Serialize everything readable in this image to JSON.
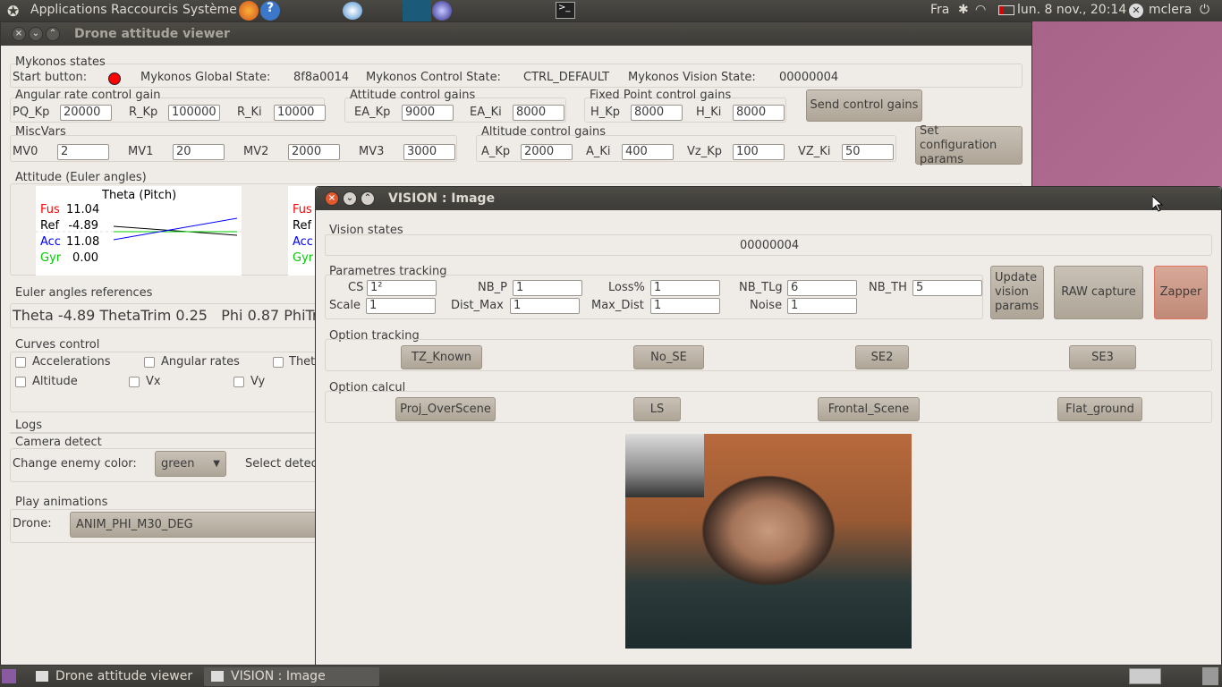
{
  "topbar": {
    "menus": [
      "Applications",
      "Raccourcis",
      "Système"
    ],
    "keyboard": "Fra",
    "datetime": "lun.  8 nov., 20:14",
    "user": "mclera"
  },
  "main_window": {
    "title": "Drone attitude viewer",
    "mykonos": {
      "title": "Mykonos states",
      "start_label": "Start button:",
      "start_color": "#ff0000",
      "global_label": "Mykonos Global State:",
      "global_value": "8f8a0014",
      "control_label": "Mykonos Control State:",
      "control_value": "CTRL_DEFAULT",
      "vision_label": "Mykonos Vision State:",
      "vision_value": "00000004"
    },
    "angular": {
      "title": "Angular rate control gain",
      "fields": [
        {
          "label": "PQ_Kp",
          "value": "20000"
        },
        {
          "label": "R_Kp",
          "value": "100000"
        },
        {
          "label": "R_Ki",
          "value": "10000"
        }
      ]
    },
    "attitude_gains": {
      "title": "Attitude control gains",
      "fields": [
        {
          "label": "EA_Kp",
          "value": "9000"
        },
        {
          "label": "EA_Ki",
          "value": "8000"
        }
      ]
    },
    "fixed_point": {
      "title": "Fixed Point control gains",
      "fields": [
        {
          "label": "H_Kp",
          "value": "8000"
        },
        {
          "label": "H_Ki",
          "value": "8000"
        }
      ]
    },
    "send_gains": "Send control gains",
    "misc": {
      "title": "MiscVars",
      "fields": [
        {
          "label": "MV0",
          "value": "2"
        },
        {
          "label": "MV1",
          "value": "20"
        },
        {
          "label": "MV2",
          "value": "2000"
        },
        {
          "label": "MV3",
          "value": "3000"
        }
      ]
    },
    "altitude": {
      "title": "Altitude control gains",
      "fields": [
        {
          "label": "A_Kp",
          "value": "2000"
        },
        {
          "label": "A_Ki",
          "value": "400"
        },
        {
          "label": "Vz_Kp",
          "value": "100"
        },
        {
          "label": "VZ_Ki",
          "value": "50"
        }
      ]
    },
    "set_config": "Set configuration params",
    "attitude": {
      "title": "Attitude (Euler angles)",
      "plot_title": "Theta (Pitch)",
      "rows": [
        {
          "label": "Fus",
          "value": "11.04",
          "color": "#ff0000"
        },
        {
          "label": "Ref",
          "value": "-4.89",
          "color": "#000000"
        },
        {
          "label": "Acc",
          "value": "11.08",
          "color": "#0000ff"
        },
        {
          "label": "Gyr",
          "value": "0.00",
          "color": "#00cc00"
        }
      ],
      "second_labels": [
        "Fus",
        "Ref",
        "Acc",
        "Gyr"
      ]
    },
    "euler_refs": {
      "title": "Euler angles references",
      "text": "Theta -4.89 ThetaTrim 0.25   Phi 0.87 PhiTr"
    },
    "curves": {
      "title": "Curves control",
      "items": [
        "Accelerations",
        "Angular rates",
        "Thet",
        "Altitude",
        "Vx",
        "Vy"
      ]
    },
    "logs": "Logs",
    "camera": {
      "title": "Camera detect",
      "color_label": "Change enemy color:",
      "color_value": "green",
      "select_label": "Select detec"
    },
    "anim": {
      "title": "Play animations",
      "drone_label": "Drone:",
      "value": "ANIM_PHI_M30_DEG"
    }
  },
  "vision_window": {
    "title": "VISION : Image",
    "states": {
      "title": "Vision states",
      "value": "00000004"
    },
    "tracking": {
      "title": "Parametres tracking",
      "fields": [
        {
          "label": "CS",
          "value": "1²"
        },
        {
          "label": "NB_P",
          "value": "1"
        },
        {
          "label": "Loss%",
          "value": "1"
        },
        {
          "label": "NB_TLg",
          "value": "6"
        },
        {
          "label": "NB_TH",
          "value": "5"
        },
        {
          "label": "Scale",
          "value": "1"
        },
        {
          "label": "Dist_Max",
          "value": "1"
        },
        {
          "label": "Max_Dist",
          "value": "1"
        },
        {
          "label": "Noise",
          "value": "1"
        }
      ]
    },
    "update_btn": "Update vision params",
    "raw_btn": "RAW capture",
    "zapper_btn": "Zapper",
    "option_tracking": {
      "title": "Option tracking",
      "buttons": [
        "TZ_Known",
        "No_SE",
        "SE2",
        "SE3"
      ]
    },
    "option_calcul": {
      "title": "Option calcul",
      "buttons": [
        "Proj_OverScene",
        "LS",
        "Frontal_Scene",
        "Flat_ground"
      ]
    }
  },
  "taskbar": {
    "items": [
      "Drone attitude viewer",
      "VISION : Image"
    ]
  }
}
